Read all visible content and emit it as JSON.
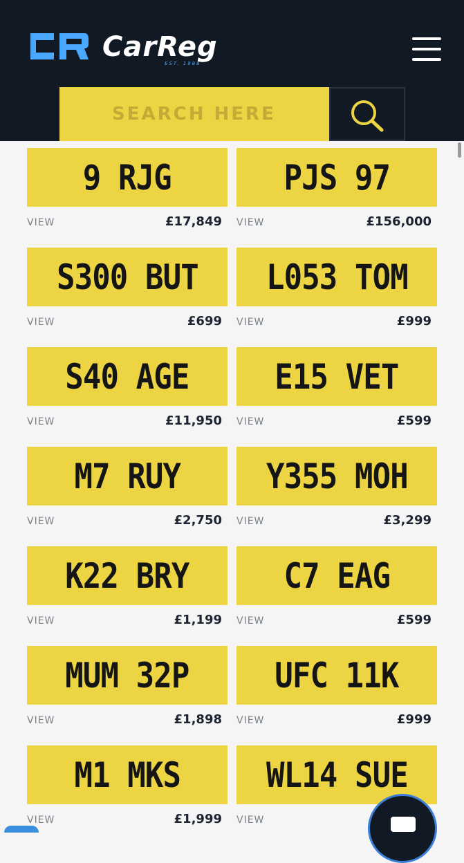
{
  "header": {
    "brand": "CarReg",
    "brand_tagline": "EST. 1988",
    "search_placeholder": "SEARCH HERE",
    "colors": {
      "bg": "#111a24",
      "accent": "#4aa8ff",
      "plate_yellow": "#ecd443"
    }
  },
  "listings": [
    {
      "plate": "9 RJG",
      "view_label": "VIEW",
      "price": "£17,849"
    },
    {
      "plate": "PJS 97",
      "view_label": "VIEW",
      "price": "£156,000"
    },
    {
      "plate": "S300 BUT",
      "view_label": "VIEW",
      "price": "£699"
    },
    {
      "plate": "L053 TOM",
      "view_label": "VIEW",
      "price": "£999"
    },
    {
      "plate": "S40 AGE",
      "view_label": "VIEW",
      "price": "£11,950"
    },
    {
      "plate": "E15 VET",
      "view_label": "VIEW",
      "price": "£599"
    },
    {
      "plate": "M7 RUY",
      "view_label": "VIEW",
      "price": "£2,750"
    },
    {
      "plate": "Y355 MOH",
      "view_label": "VIEW",
      "price": "£3,299"
    },
    {
      "plate": "K22 BRY",
      "view_label": "VIEW",
      "price": "£1,199"
    },
    {
      "plate": "C7 EAG",
      "view_label": "VIEW",
      "price": "£599"
    },
    {
      "plate": "MUM 32P",
      "view_label": "VIEW",
      "price": "£1,898"
    },
    {
      "plate": "UFC 11K",
      "view_label": "VIEW",
      "price": "£999"
    },
    {
      "plate": "M1 MKS",
      "view_label": "VIEW",
      "price": "£1,999"
    },
    {
      "plate": "WL14 SUE",
      "view_label": "VIEW",
      "price": ""
    }
  ],
  "icons": {
    "menu": "hamburger-icon",
    "search": "search-icon",
    "chat": "chat-icon"
  }
}
